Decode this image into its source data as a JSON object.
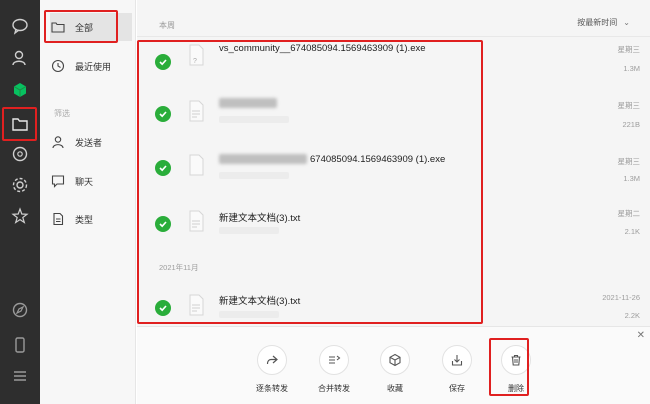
{
  "nav": {
    "items": [
      {
        "label": "全部",
        "icon": "folder-icon"
      },
      {
        "label": "最近使用",
        "icon": "clock-icon"
      }
    ],
    "section_label": "筛选",
    "filters": [
      {
        "label": "发送者",
        "icon": "person-icon"
      },
      {
        "label": "聊天",
        "icon": "chat-icon"
      },
      {
        "label": "类型",
        "icon": "document-icon"
      }
    ]
  },
  "list": {
    "group_this_week": "本周",
    "sort_label": "按最新时间",
    "group_month": "2021年11月",
    "files": [
      {
        "name": "vs_community__674085094.1569463909 (1).exe",
        "sub": "?",
        "date": "星期三",
        "size": "1.3M"
      },
      {
        "name": "",
        "sub": "",
        "date": "星期三",
        "size": "221B"
      },
      {
        "name": "674085094.1569463909 (1).exe",
        "sub": "",
        "date": "星期三",
        "size": "1.3M"
      },
      {
        "name": "新建文本文档(3).txt",
        "sub": "",
        "date": "星期二",
        "size": "2.1K"
      },
      {
        "name": "新建文本文档(3).txt",
        "sub": "",
        "date": "2021-11-26",
        "size": "2.2K"
      }
    ]
  },
  "actions": [
    {
      "label": "逐条转发",
      "icon": "forward-icon"
    },
    {
      "label": "合并转发",
      "icon": "merge-forward-icon"
    },
    {
      "label": "收藏",
      "icon": "favorite-cube-icon"
    },
    {
      "label": "保存",
      "icon": "save-icon"
    },
    {
      "label": "删除",
      "icon": "trash-icon"
    }
  ],
  "colors": {
    "rail": "#2e2e2e",
    "check_green": "#2aad3a",
    "highlight_red": "#e02020",
    "wechat_green": "#07c160"
  }
}
